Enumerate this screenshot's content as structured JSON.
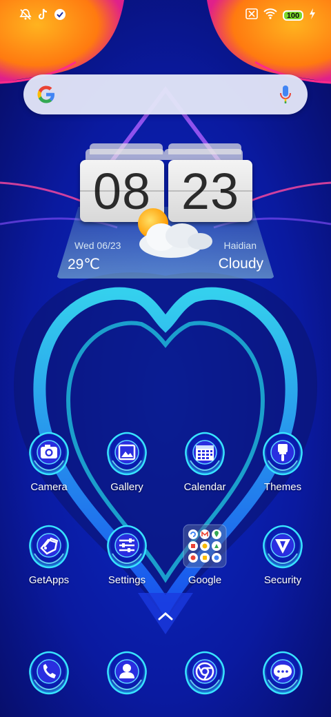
{
  "status_bar": {
    "left_icons": [
      "mute-alarm-icon",
      "tiktok-icon",
      "check-badge-icon"
    ],
    "right_icons": [
      "sim-off-icon",
      "wifi-icon"
    ],
    "battery_level": "100",
    "charging": true
  },
  "search": {
    "logo": "google-g-icon",
    "mic": "mic-icon"
  },
  "clock": {
    "hours": "08",
    "minutes": "23"
  },
  "weather": {
    "date": "Wed  06/23",
    "city": "Haidian",
    "temperature": "29℃",
    "condition": "Cloudy",
    "icon": "partly-cloudy-icon"
  },
  "apps_row1": [
    {
      "label": "Camera",
      "icon": "camera-icon"
    },
    {
      "label": "Gallery",
      "icon": "gallery-icon"
    },
    {
      "label": "Calendar",
      "icon": "calendar-icon"
    },
    {
      "label": "Themes",
      "icon": "brush-icon"
    }
  ],
  "apps_row2": [
    {
      "label": "GetApps",
      "icon": "getapps-icon"
    },
    {
      "label": "Settings",
      "icon": "sliders-icon"
    },
    {
      "label": "Google",
      "icon": "folder-icon"
    },
    {
      "label": "Security",
      "icon": "shield-icon"
    }
  ],
  "dock": [
    {
      "icon": "phone-icon"
    },
    {
      "icon": "contacts-icon"
    },
    {
      "icon": "chrome-icon"
    },
    {
      "icon": "messages-icon"
    }
  ],
  "colors": {
    "background": "#0a1a8a",
    "accent_cyan": "#2ee0ff",
    "sun_orange": "#ff8a1a"
  }
}
